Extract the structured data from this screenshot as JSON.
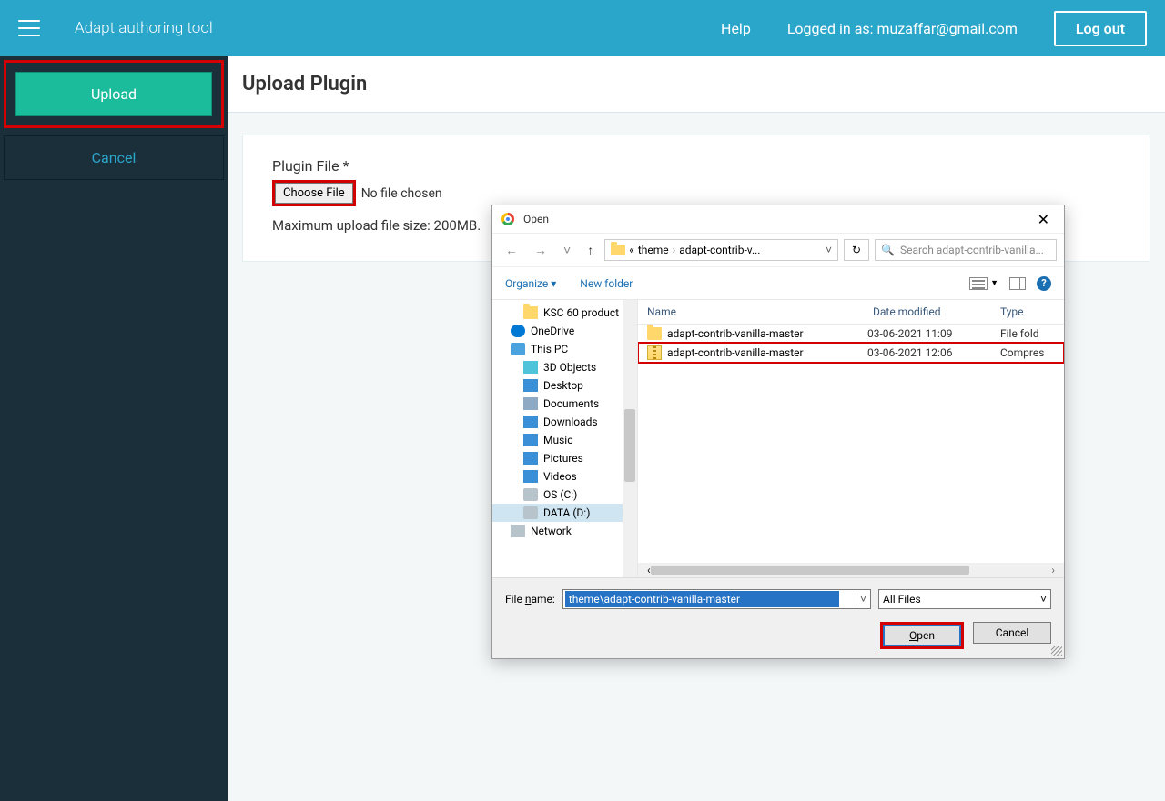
{
  "topbar": {
    "app_title": "Adapt authoring tool",
    "help": "Help",
    "logged_in": "Logged in as: muzaffar@gmail.com",
    "logout": "Log out"
  },
  "sidebar": {
    "upload": "Upload",
    "cancel": "Cancel"
  },
  "page": {
    "title": "Upload Plugin",
    "field_label": "Plugin File *",
    "choose": "Choose File",
    "nofile": "No file chosen",
    "maxsize": "Maximum upload file size: 200MB."
  },
  "dialog": {
    "title": "Open",
    "breadcrumb": {
      "prefix": "«",
      "part1": "theme",
      "part2": "adapt-contrib-v..."
    },
    "search_placeholder": "Search adapt-contrib-vanilla...",
    "organize": "Organize",
    "newfolder": "New folder",
    "tree": [
      {
        "label": "KSC 60 product",
        "icon": "folder",
        "indent": true
      },
      {
        "label": "OneDrive",
        "icon": "cloud"
      },
      {
        "label": "This PC",
        "icon": "pc"
      },
      {
        "label": "3D Objects",
        "icon": "3d",
        "indent": true
      },
      {
        "label": "Desktop",
        "icon": "desktop",
        "indent": true
      },
      {
        "label": "Documents",
        "icon": "doc",
        "indent": true
      },
      {
        "label": "Downloads",
        "icon": "dl",
        "indent": true
      },
      {
        "label": "Music",
        "icon": "music",
        "indent": true
      },
      {
        "label": "Pictures",
        "icon": "pic",
        "indent": true
      },
      {
        "label": "Videos",
        "icon": "vid",
        "indent": true
      },
      {
        "label": "OS (C:)",
        "icon": "drive",
        "indent": true
      },
      {
        "label": "DATA (D:)",
        "icon": "drive",
        "indent": true,
        "selected": true
      },
      {
        "label": "Network",
        "icon": "net"
      }
    ],
    "list_headers": {
      "name": "Name",
      "date": "Date modified",
      "type": "Type"
    },
    "rows": [
      {
        "name": "adapt-contrib-vanilla-master",
        "date": "03-06-2021 11:09",
        "type": "File fold",
        "icon": "folder"
      },
      {
        "name": "adapt-contrib-vanilla-master",
        "date": "03-06-2021 12:06",
        "type": "Compres",
        "icon": "zip",
        "selected": true
      }
    ],
    "file_name_label": "File name:",
    "file_name_value": "theme\\adapt-contrib-vanilla-master",
    "filter": "All Files",
    "open": "Open",
    "cancel": "Cancel"
  }
}
